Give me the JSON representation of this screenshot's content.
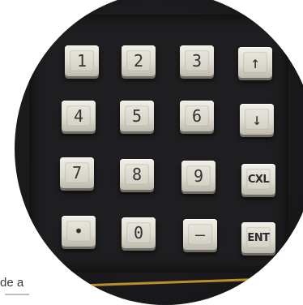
{
  "keypad": {
    "rows": [
      [
        "1",
        "2",
        "3",
        "↑"
      ],
      [
        "4",
        "5",
        "6",
        "↓"
      ],
      [
        "7",
        "8",
        "9",
        "CXL"
      ],
      [
        "•",
        "0",
        "–",
        "ENT"
      ]
    ]
  },
  "caption": {
    "fragment": "de a"
  }
}
